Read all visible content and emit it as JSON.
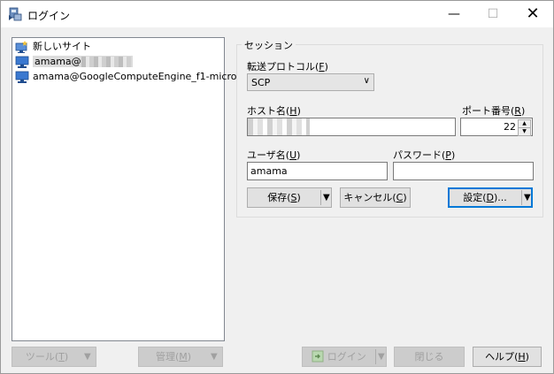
{
  "window": {
    "title": "ログイン"
  },
  "sites": [
    {
      "label": "新しいサイト"
    },
    {
      "label": "amama@"
    },
    {
      "label": "amama@GoogleComputeEngine_f1-micro"
    }
  ],
  "session": {
    "group_label": "セッション",
    "protocol_label": "転送プロトコル",
    "protocol_key": "F",
    "protocol_value": "SCP",
    "host_label": "ホスト名",
    "host_key": "H",
    "port_label": "ポート番号",
    "port_key": "R",
    "port_value": "22",
    "user_label": "ユーザ名",
    "user_key": "U",
    "user_value": "amama",
    "password_label": "パスワード",
    "password_key": "P",
    "password_value": ""
  },
  "buttons": {
    "save": "保存",
    "save_key": "S",
    "cancel": "キャンセル",
    "cancel_key": "C",
    "settings": "設定",
    "settings_key": "D",
    "settings_suffix": "...",
    "tools": "ツール",
    "tools_key": "T",
    "manage": "管理",
    "manage_key": "M",
    "login": "ログイン",
    "close": "閉じる",
    "help": "ヘルプ",
    "help_key": "H"
  }
}
